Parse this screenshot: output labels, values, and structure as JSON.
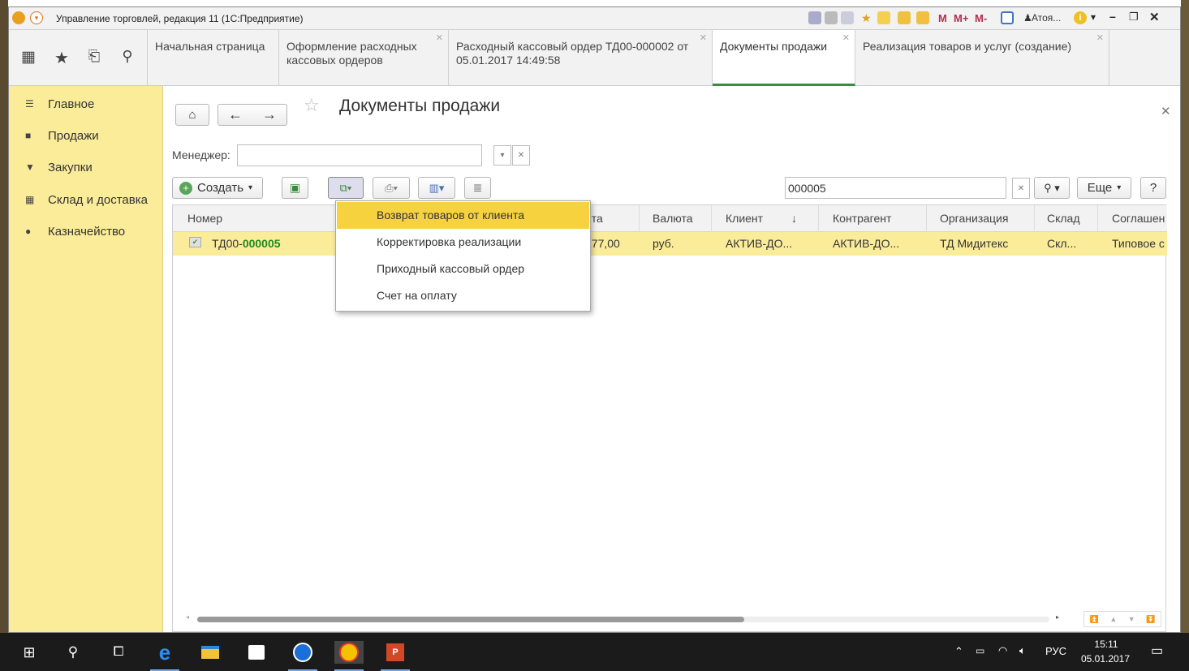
{
  "window": {
    "title": "Управление торговлей, редакция 11 (1С:Предприятие)",
    "user": "Атоя..."
  },
  "title_tools": [
    "M",
    "M+",
    "M-"
  ],
  "tabs": [
    {
      "label": "Начальная страница"
    },
    {
      "label": "Оформление расходных кассовых ордеров"
    },
    {
      "label": "Расходный кассовый ордер ТД00-000002 от 05.01.2017 14:49:58"
    },
    {
      "label": "Документы продажи"
    },
    {
      "label": "Реализация товаров и услуг (создание)"
    }
  ],
  "sidebar": {
    "items": [
      {
        "label": "Главное",
        "icon": "menu-icon"
      },
      {
        "label": "Продажи",
        "icon": "bag-icon"
      },
      {
        "label": "Закупки",
        "icon": "cart-icon"
      },
      {
        "label": "Склад и доставка",
        "icon": "warehouse-icon"
      },
      {
        "label": "Казначейство",
        "icon": "coin-icon"
      }
    ]
  },
  "page": {
    "title": "Документы продажи"
  },
  "filter": {
    "manager_label": "Менеджер:",
    "manager_value": ""
  },
  "toolbar": {
    "create_label": "Создать",
    "search_value": "000005",
    "more_label": "Еще",
    "help_label": "?"
  },
  "grid": {
    "columns": [
      "Номер",
      "нта",
      "Валюта",
      "Клиент",
      "Контрагент",
      "Организация",
      "Склад",
      "Соглашен"
    ],
    "sort_indicator": "↓",
    "row": {
      "prefix": "ТД00-",
      "number": "000005",
      "amount": "277,00",
      "currency": "руб.",
      "client": "АКТИВ-ДО...",
      "counterparty": "АКТИВ-ДО...",
      "organization": "ТД Мидитекс",
      "warehouse": "Скл...",
      "agreement": "Типовое с"
    }
  },
  "dropdown_menu": {
    "items": [
      "Возврат товаров от клиента",
      "Корректировка реализации",
      "Приходный кассовый ордер",
      "Счет на оплату"
    ],
    "selected_index": 0
  },
  "taskbar": {
    "lang": "РУС",
    "time": "15:11",
    "date": "05.01.2017"
  },
  "colors": {
    "accent_yellow": "#fbec9a",
    "menu_highlight": "#f7d23f",
    "active_tab_underline": "#3b8a45",
    "doc_number_green": "#1e8a1e"
  }
}
